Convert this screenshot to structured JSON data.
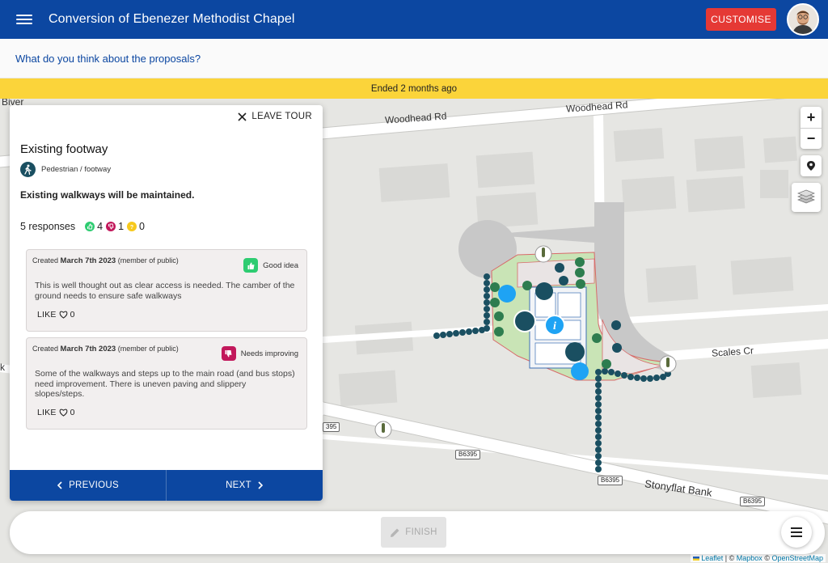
{
  "appbar": {
    "title": "Conversion of Ebenezer Methodist Chapel",
    "customise_label": "CUSTOMISE",
    "brand_color": "#0c47a1",
    "customise_color": "#e53935"
  },
  "subheader": {
    "question": "What do you think about the proposals?"
  },
  "banner": {
    "text": "Ended 2 months ago",
    "color": "#fbd43a"
  },
  "map": {
    "labels": {
      "woodhead_1": "Woodhead Rd",
      "woodhead_2": "Woodhead Rd",
      "scales": "Scales Cr",
      "stonyflat": "Stonyflat Bank",
      "bivert": "Biver",
      "b_left": "k"
    },
    "road_badges": {
      "b1": "B6395",
      "b2": "B6395",
      "b3": "B6395",
      "b4": "395"
    },
    "controls": {
      "zoom_in": "+",
      "zoom_out": "−"
    },
    "attribution": {
      "leaflet": "Leaflet",
      "sep1": " | © ",
      "mapbox": "Mapbox",
      "sep2": " © ",
      "osm": "OpenStreetMap"
    }
  },
  "tour": {
    "leave_label": "LEAVE TOUR",
    "title": "Existing footway",
    "category": "Pedestrian / footway",
    "description": "Existing walkways will be maintained.",
    "responses_label": "5 responses",
    "counts": {
      "good": "4",
      "improve": "1",
      "neutral": "0"
    },
    "comments": [
      {
        "created_prefix": "Created",
        "date": "March 7th 2023",
        "author": "(member of public)",
        "reaction": "Good idea",
        "text": "This is well thought out as clear access is needed. The camber of the ground needs to ensure safe walkways",
        "like_label": "LIKE",
        "like_count": "0"
      },
      {
        "created_prefix": "Created",
        "date": "March 7th 2023",
        "author": "(member of public)",
        "reaction": "Needs improving",
        "text": "Some of the walkways and steps up to the main road (and bus stops) need improvement. There is uneven paving and slippery slopes/steps.",
        "like_label": "LIKE",
        "like_count": "0"
      }
    ],
    "previous_label": "PREVIOUS",
    "next_label": "NEXT"
  },
  "bottom": {
    "finish_label": "FINISH"
  },
  "icons": {
    "menu": "hamburger-menu-icon",
    "close": "close-icon",
    "pedestrian": "pedestrian-icon",
    "thumbs_up": "thumbs-up-icon",
    "thumbs_down": "thumbs-down-icon",
    "heart": "heart-icon",
    "pencil": "pencil-icon",
    "layers": "layers-icon",
    "marker": "map-marker-icon"
  }
}
